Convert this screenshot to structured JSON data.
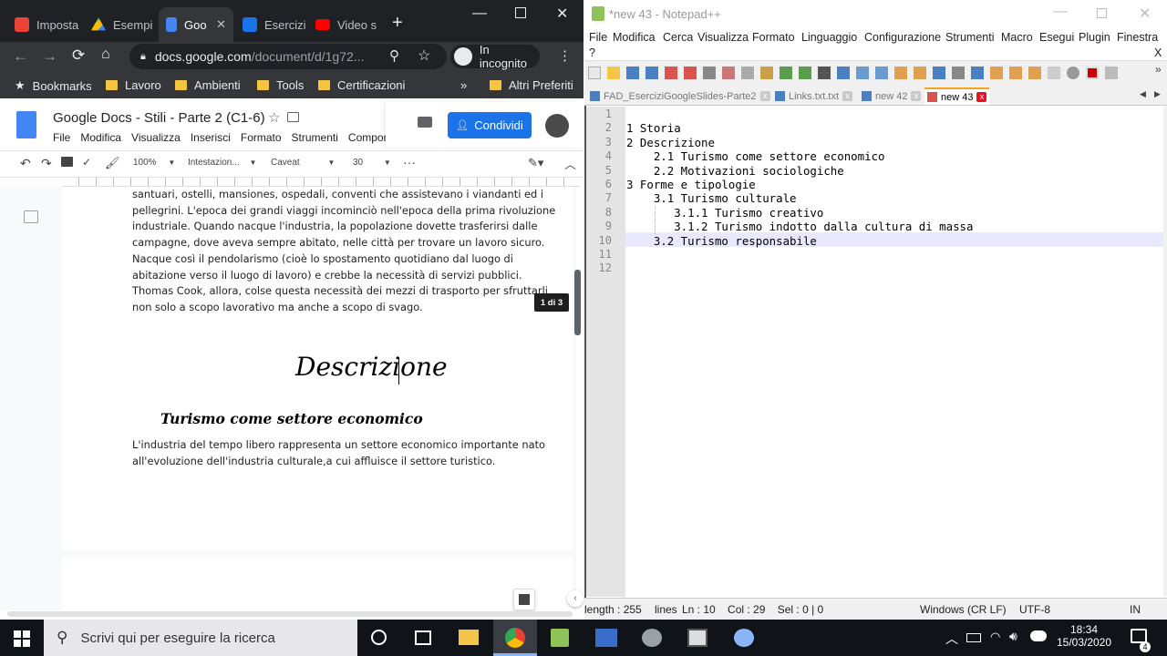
{
  "chrome": {
    "tabs": [
      {
        "label": "Imposta",
        "color": "#ea4335"
      },
      {
        "label": "Esempi",
        "color": "#34a853"
      },
      {
        "label": "Goo",
        "color": "#4285f4"
      },
      {
        "label": "Esercizi",
        "color": "#1a73e8"
      },
      {
        "label": "Video s",
        "color": "#ff0000"
      }
    ],
    "new_tab": "+",
    "url_host": "docs.google.com",
    "url_path": "/document/d/1g72...",
    "incognito": "In incognito",
    "bookmarks_label": "Bookmarks",
    "bookmark_folders": [
      "Lavoro",
      "Ambienti",
      "Tools",
      "Certificazioni"
    ],
    "more": "»",
    "other_bookmarks": "Altri Preferiti"
  },
  "docs": {
    "title": "Google Docs - Stili - Parte 2 (C1-6)",
    "menu": [
      "File",
      "Modifica",
      "Visualizza",
      "Inserisci",
      "Formato",
      "Strumenti",
      "Compone"
    ],
    "share": "Condividi",
    "zoom": "100%",
    "style": "Intestazion...",
    "font": "Caveat",
    "size": "30",
    "page_badge": "1 di 3",
    "body_lines": [
      "santuari, ostelli, mansiones, ospedali, conventi che assistevano i viandanti ed i",
      "pellegrini. L'epoca dei grandi viaggi incominciò nell'epoca della prima rivoluzione",
      "industriale. Quando nacque l'industria, la popolazione dovette trasferirsi dalle",
      "campagne, dove aveva sempre abitato, nelle città per trovare un lavoro sicuro.",
      "Nacque così il pendolarismo (cioè lo spostamento quotidiano dal luogo di",
      "abitazione verso il luogo di lavoro) e crebbe la necessità di servizi pubblici.",
      "Thomas Cook, allora, colse questa necessità dei mezzi di trasporto per sfruttarli",
      "non solo a scopo lavorativo ma anche a scopo di svago."
    ],
    "heading": "Descrizione",
    "subheading": "Turismo come settore economico",
    "sub_lines": [
      "L'industria del tempo libero rappresenta un settore economico importante nato",
      "all'evoluzione dell'industria culturale,a cui affluisce il settore turistico."
    ]
  },
  "npp": {
    "title": "*new 43 - Notepad++",
    "menu": [
      "File",
      "Modifica",
      "Cerca",
      "Visualizza",
      "Formato",
      "Linguaggio",
      "Configurazione",
      "Strumenti",
      "Macro",
      "Esegui",
      "Plugin",
      "Finestra",
      "?"
    ],
    "close_x": "X",
    "tabs": [
      "FAD_EserciziGoogleSlides-Parte2",
      "Links.txt.txt",
      "new 42",
      "new 43"
    ],
    "lines": [
      "",
      "1 Storia",
      "2 Descrizione",
      "    2.1 Turismo come settore economico",
      "    2.2 Motivazioni sociologiche",
      "3 Forme e tipologie",
      "    3.1 Turismo culturale",
      "       3.1.1 Turismo creativo",
      "       3.1.2 Turismo indotto dalla cultura di massa",
      "    3.2 Turismo responsabile",
      "",
      ""
    ],
    "line_numbers": [
      "1",
      "2",
      "3",
      "4",
      "5",
      "6",
      "7",
      "8",
      "9",
      "10",
      "11",
      "12"
    ],
    "status": {
      "length": "length : 255",
      "lines": "lines",
      "pos": "Ln : 10    Col : 29    Sel : 0 | 0",
      "eol": "Windows (CR LF)",
      "enc": "UTF-8",
      "mode": "IN"
    }
  },
  "taskbar": {
    "search": "Scrivi qui per eseguire la ricerca",
    "time": "18:34",
    "date": "15/03/2020",
    "notif": "4"
  }
}
